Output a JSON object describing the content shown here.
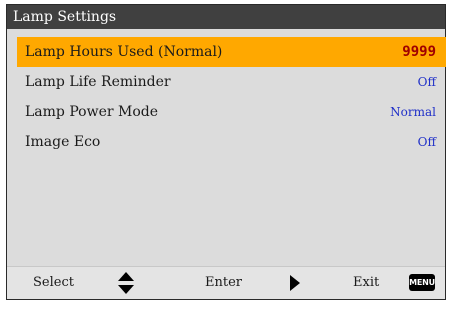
{
  "window": {
    "title": "Lamp Settings"
  },
  "menu": {
    "items": [
      {
        "label": "Lamp Hours Used (Normal)",
        "value": "9999",
        "selected": true
      },
      {
        "label": "Lamp Life Reminder",
        "value": "Off",
        "selected": false
      },
      {
        "label": "Lamp Power Mode",
        "value": "Normal",
        "selected": false
      },
      {
        "label": "Image Eco",
        "value": "Off",
        "selected": false
      }
    ]
  },
  "footer": {
    "select_label": "Select",
    "enter_label": "Enter",
    "exit_label": "Exit",
    "menu_key_label": "MENU"
  },
  "colors": {
    "highlight": "#ffa800",
    "title_bar": "#404040",
    "value_text": "#2030c8",
    "counter_text": "#a00000"
  },
  "icons": {
    "select": "up-down-arrow-icon",
    "enter": "right-arrow-icon",
    "exit": "menu-key-icon"
  }
}
